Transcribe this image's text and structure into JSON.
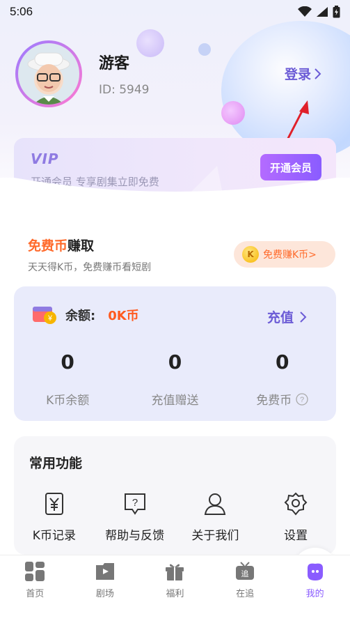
{
  "status": {
    "time": "5:06"
  },
  "user": {
    "name": "游客",
    "id": "ID: 5949",
    "login_label": "登录"
  },
  "vip": {
    "logo": "VIP",
    "description": "开通会员  专享剧集立即免费",
    "open_label": "开通会员"
  },
  "earn": {
    "title_accent": "免费币",
    "title_rest": "赚取",
    "subtitle": "天天得K币，免费赚币看短剧",
    "button_label": "免费赚K币>",
    "coin_letter": "K"
  },
  "wallet": {
    "label": "余额:",
    "amount": "0K币",
    "recharge_label": "充值",
    "stats": [
      {
        "value": "0",
        "label": "K币余额"
      },
      {
        "value": "0",
        "label": "充值赠送"
      },
      {
        "value": "0",
        "label": "免费币"
      }
    ]
  },
  "tools": {
    "title": "常用功能",
    "items": [
      {
        "label": "K币记录",
        "icon": "yuan-doc-icon"
      },
      {
        "label": "帮助与反馈",
        "icon": "help-chat-icon"
      },
      {
        "label": "关于我们",
        "icon": "person-icon"
      },
      {
        "label": "设置",
        "icon": "gear-icon"
      }
    ]
  },
  "tabs": [
    {
      "label": "首页",
      "icon": "home-grid-icon",
      "active": false
    },
    {
      "label": "剧场",
      "icon": "theater-play-icon",
      "active": false
    },
    {
      "label": "福利",
      "icon": "gift-icon",
      "active": false
    },
    {
      "label": "在追",
      "icon": "tv-follow-icon",
      "active": false
    },
    {
      "label": "我的",
      "icon": "mine-face-icon",
      "active": true
    }
  ],
  "colors": {
    "accent": "#6b5bd6",
    "orange": "#ff6a2b",
    "purple": "#8a5cff"
  }
}
